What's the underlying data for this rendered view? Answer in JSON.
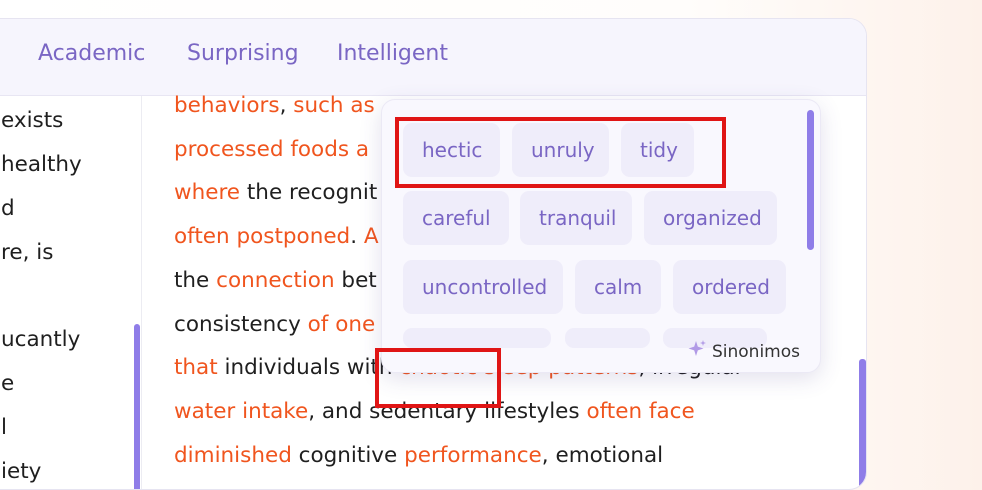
{
  "tabs": [
    "Academic",
    "Surprising",
    "Intelligent"
  ],
  "left_lines": [
    "exists",
    "healthy",
    "d",
    "re, is",
    "",
    "ucantly",
    "e",
    "l",
    "iety"
  ],
  "main_lines": [
    [
      {
        "t": "behaviors",
        "o": true
      },
      {
        "t": ", ",
        "o": false
      },
      {
        "t": "such as",
        "o": true
      }
    ],
    [
      {
        "t": "processed foods a",
        "o": true
      }
    ],
    [
      {
        "t": "where",
        "o": true
      },
      {
        "t": " the recognit",
        "o": false
      }
    ],
    [
      {
        "t": "often postponed",
        "o": true
      },
      {
        "t": ". ",
        "o": false
      },
      {
        "t": "A",
        "o": true
      }
    ],
    [
      {
        "t": "the ",
        "o": false
      },
      {
        "t": "connection",
        "o": true
      },
      {
        "t": " bet",
        "o": false
      }
    ],
    [
      {
        "t": "consistency ",
        "o": false
      },
      {
        "t": "of one",
        "o": true
      }
    ],
    [
      {
        "t": "that",
        "o": true
      },
      {
        "t": " individuals with ",
        "o": false
      },
      {
        "t": "chaotic sleep patterns",
        "o": true
      },
      {
        "t": ", irregular",
        "o": false
      }
    ],
    [
      {
        "t": "water intake",
        "o": true
      },
      {
        "t": ", and sedentary lifestyles ",
        "o": false
      },
      {
        "t": "often face",
        "o": true
      }
    ],
    [
      {
        "t": "diminished",
        "o": true
      },
      {
        "t": " cognitive ",
        "o": false
      },
      {
        "t": "performance",
        "o": true
      },
      {
        "t": ", emotional",
        "o": false
      }
    ]
  ],
  "synonyms": [
    [
      "hectic",
      "unruly",
      "tidy"
    ],
    [
      "careful",
      "tranquil",
      "organized"
    ],
    [
      "uncontrolled",
      "calm",
      "ordered"
    ]
  ],
  "footer_label": "Sinonimos",
  "colors": {
    "accent": "#7a66c4",
    "highlight": "#f0551e",
    "annotation": "#e01515"
  }
}
